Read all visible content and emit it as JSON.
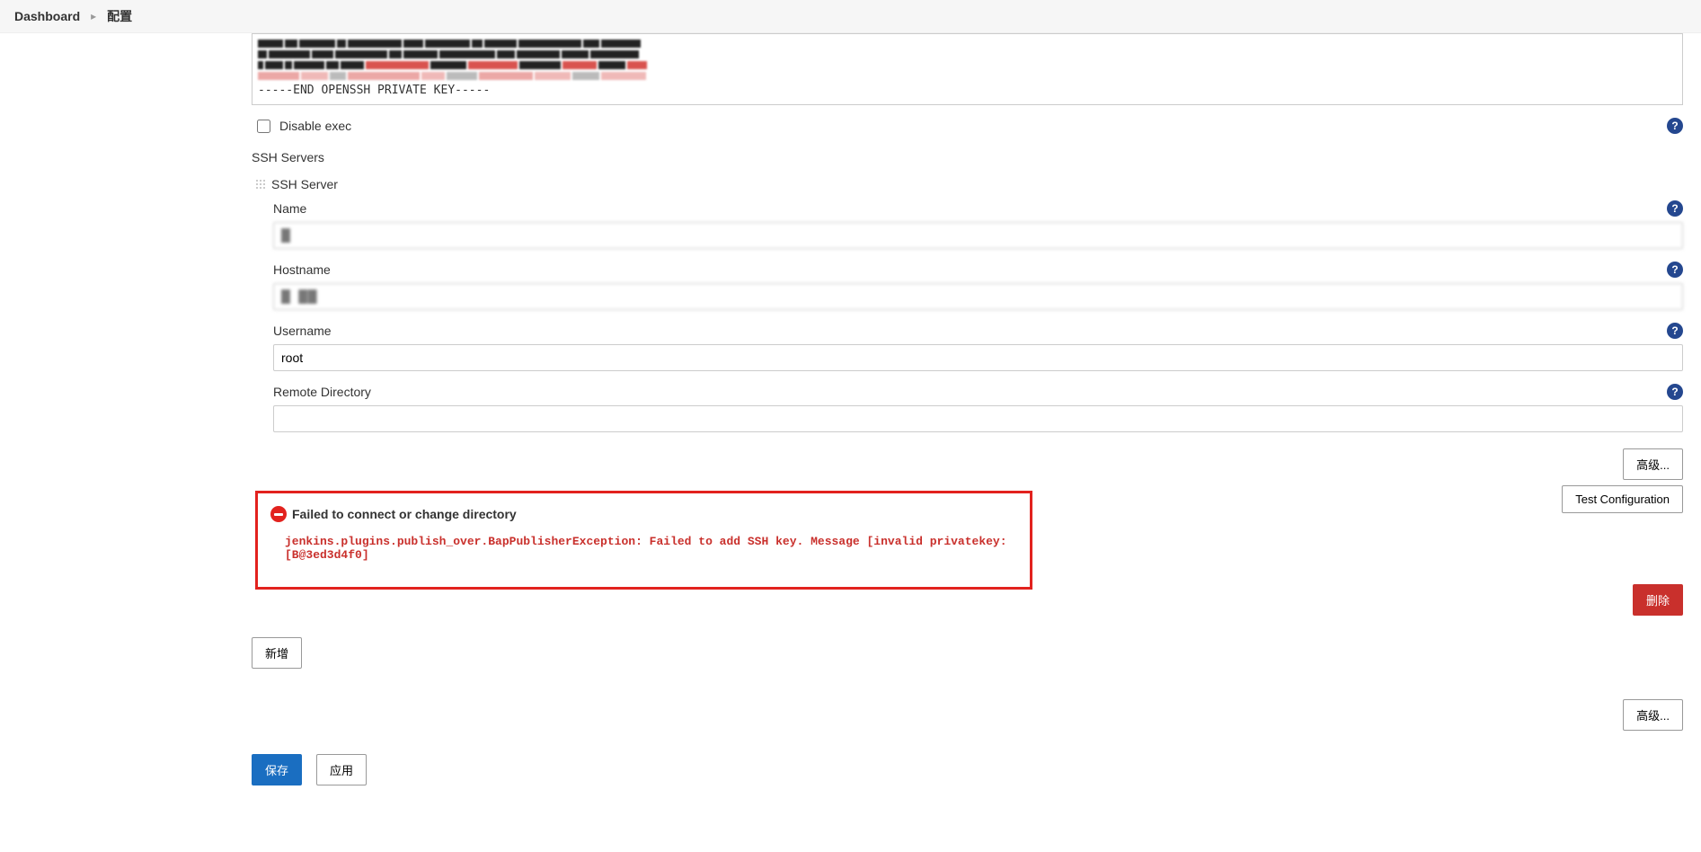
{
  "breadcrumb": {
    "dashboard": "Dashboard",
    "config": "配置"
  },
  "key_footer": "-----END OPENSSH PRIVATE KEY-----",
  "disable_exec_label": "Disable exec",
  "section_ssh_servers": "SSH Servers",
  "ssh_server_label": "SSH Server",
  "fields": {
    "name": {
      "label": "Name",
      "value": "█"
    },
    "hostname": {
      "label": "Hostname",
      "value": "█  ██"
    },
    "username": {
      "label": "Username",
      "value": "root"
    },
    "remote_dir": {
      "label": "Remote Directory",
      "value": ""
    }
  },
  "buttons": {
    "advanced": "高级...",
    "test_config": "Test Configuration",
    "delete": "删除",
    "add": "新增",
    "save": "保存",
    "apply": "应用"
  },
  "error": {
    "title": "Failed to connect or change directory",
    "body": "jenkins.plugins.publish_over.BapPublisherException: Failed to add SSH key. Message [invalid privatekey: [B@3ed3d4f0]"
  }
}
